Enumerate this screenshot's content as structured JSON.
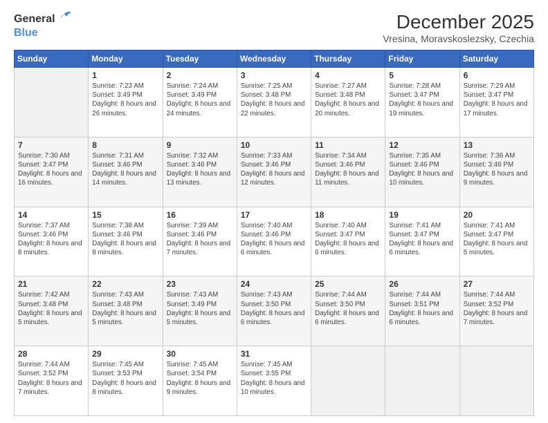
{
  "header": {
    "logo_general": "General",
    "logo_blue": "Blue",
    "month": "December 2025",
    "location": "Vresina, Moravskoslezsky, Czechia"
  },
  "days_of_week": [
    "Sunday",
    "Monday",
    "Tuesday",
    "Wednesday",
    "Thursday",
    "Friday",
    "Saturday"
  ],
  "weeks": [
    [
      {
        "day": "",
        "info": ""
      },
      {
        "day": "1",
        "info": "Sunrise: 7:23 AM\nSunset: 3:49 PM\nDaylight: 8 hours and 26 minutes."
      },
      {
        "day": "2",
        "info": "Sunrise: 7:24 AM\nSunset: 3:49 PM\nDaylight: 8 hours and 24 minutes."
      },
      {
        "day": "3",
        "info": "Sunrise: 7:25 AM\nSunset: 3:48 PM\nDaylight: 8 hours and 22 minutes."
      },
      {
        "day": "4",
        "info": "Sunrise: 7:27 AM\nSunset: 3:48 PM\nDaylight: 8 hours and 20 minutes."
      },
      {
        "day": "5",
        "info": "Sunrise: 7:28 AM\nSunset: 3:47 PM\nDaylight: 8 hours and 19 minutes."
      },
      {
        "day": "6",
        "info": "Sunrise: 7:29 AM\nSunset: 3:47 PM\nDaylight: 8 hours and 17 minutes."
      }
    ],
    [
      {
        "day": "7",
        "info": "Sunrise: 7:30 AM\nSunset: 3:47 PM\nDaylight: 8 hours and 16 minutes."
      },
      {
        "day": "8",
        "info": "Sunrise: 7:31 AM\nSunset: 3:46 PM\nDaylight: 8 hours and 14 minutes."
      },
      {
        "day": "9",
        "info": "Sunrise: 7:32 AM\nSunset: 3:46 PM\nDaylight: 8 hours and 13 minutes."
      },
      {
        "day": "10",
        "info": "Sunrise: 7:33 AM\nSunset: 3:46 PM\nDaylight: 8 hours and 12 minutes."
      },
      {
        "day": "11",
        "info": "Sunrise: 7:34 AM\nSunset: 3:46 PM\nDaylight: 8 hours and 11 minutes."
      },
      {
        "day": "12",
        "info": "Sunrise: 7:35 AM\nSunset: 3:46 PM\nDaylight: 8 hours and 10 minutes."
      },
      {
        "day": "13",
        "info": "Sunrise: 7:36 AM\nSunset: 3:46 PM\nDaylight: 8 hours and 9 minutes."
      }
    ],
    [
      {
        "day": "14",
        "info": "Sunrise: 7:37 AM\nSunset: 3:46 PM\nDaylight: 8 hours and 8 minutes."
      },
      {
        "day": "15",
        "info": "Sunrise: 7:38 AM\nSunset: 3:46 PM\nDaylight: 8 hours and 8 minutes."
      },
      {
        "day": "16",
        "info": "Sunrise: 7:39 AM\nSunset: 3:46 PM\nDaylight: 8 hours and 7 minutes."
      },
      {
        "day": "17",
        "info": "Sunrise: 7:40 AM\nSunset: 3:46 PM\nDaylight: 8 hours and 6 minutes."
      },
      {
        "day": "18",
        "info": "Sunrise: 7:40 AM\nSunset: 3:47 PM\nDaylight: 8 hours and 6 minutes."
      },
      {
        "day": "19",
        "info": "Sunrise: 7:41 AM\nSunset: 3:47 PM\nDaylight: 8 hours and 6 minutes."
      },
      {
        "day": "20",
        "info": "Sunrise: 7:41 AM\nSunset: 3:47 PM\nDaylight: 8 hours and 5 minutes."
      }
    ],
    [
      {
        "day": "21",
        "info": "Sunrise: 7:42 AM\nSunset: 3:48 PM\nDaylight: 8 hours and 5 minutes."
      },
      {
        "day": "22",
        "info": "Sunrise: 7:43 AM\nSunset: 3:48 PM\nDaylight: 8 hours and 5 minutes."
      },
      {
        "day": "23",
        "info": "Sunrise: 7:43 AM\nSunset: 3:49 PM\nDaylight: 8 hours and 5 minutes."
      },
      {
        "day": "24",
        "info": "Sunrise: 7:43 AM\nSunset: 3:50 PM\nDaylight: 8 hours and 6 minutes."
      },
      {
        "day": "25",
        "info": "Sunrise: 7:44 AM\nSunset: 3:50 PM\nDaylight: 8 hours and 6 minutes."
      },
      {
        "day": "26",
        "info": "Sunrise: 7:44 AM\nSunset: 3:51 PM\nDaylight: 8 hours and 6 minutes."
      },
      {
        "day": "27",
        "info": "Sunrise: 7:44 AM\nSunset: 3:52 PM\nDaylight: 8 hours and 7 minutes."
      }
    ],
    [
      {
        "day": "28",
        "info": "Sunrise: 7:44 AM\nSunset: 3:52 PM\nDaylight: 8 hours and 7 minutes."
      },
      {
        "day": "29",
        "info": "Sunrise: 7:45 AM\nSunset: 3:53 PM\nDaylight: 8 hours and 8 minutes."
      },
      {
        "day": "30",
        "info": "Sunrise: 7:45 AM\nSunset: 3:54 PM\nDaylight: 8 hours and 9 minutes."
      },
      {
        "day": "31",
        "info": "Sunrise: 7:45 AM\nSunset: 3:55 PM\nDaylight: 8 hours and 10 minutes."
      },
      {
        "day": "",
        "info": ""
      },
      {
        "day": "",
        "info": ""
      },
      {
        "day": "",
        "info": ""
      }
    ]
  ]
}
